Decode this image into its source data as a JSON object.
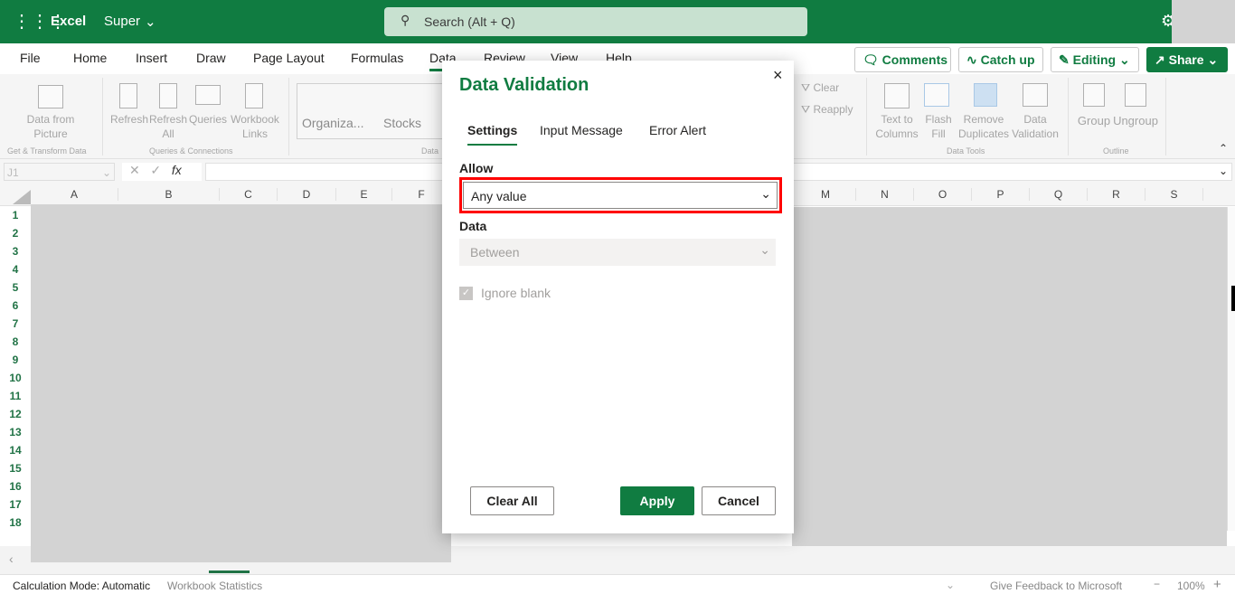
{
  "app": {
    "name": "Excel",
    "doc": "Super",
    "search_placeholder": "Search (Alt + Q)"
  },
  "tabs": [
    "File",
    "Home",
    "Insert",
    "Draw",
    "Page Layout",
    "Formulas",
    "Data",
    "Review",
    "View",
    "Help"
  ],
  "active_tab": "Data",
  "header_buttons": {
    "comments": "Comments",
    "catch_up": "Catch up",
    "editing": "Editing",
    "share": "Share"
  },
  "ribbon": {
    "data_from_picture": "Data from Picture",
    "refresh": "Refresh",
    "refresh_all": "Refresh All",
    "queries": "Queries",
    "workbook_links": "Workbook Links",
    "organiza": "Organiza...",
    "stocks": "Stocks",
    "clear": "Clear",
    "reapply": "Reapply",
    "text_to_columns": "Text to Columns",
    "flash_fill": "Flash Fill",
    "remove_duplicates": "Remove Duplicates",
    "data_validation": "Data Validation",
    "group": "Group",
    "ungroup": "Ungroup",
    "groups": {
      "get_transform": "Get & Transform Data",
      "queries_connections": "Queries & Connections",
      "data_types": "Data",
      "data_tools": "Data Tools",
      "outline": "Outline"
    }
  },
  "formula_bar": {
    "name_box": "J1",
    "fx": "fx",
    "value": ""
  },
  "columns": [
    "A",
    "B",
    "C",
    "D",
    "E",
    "F",
    "M",
    "N",
    "O",
    "P",
    "Q",
    "R",
    "S"
  ],
  "rows": [
    "1",
    "2",
    "3",
    "4",
    "5",
    "6",
    "7",
    "8",
    "9",
    "10",
    "11",
    "12",
    "13",
    "14",
    "15",
    "16",
    "17",
    "18"
  ],
  "dialog": {
    "title": "Data Validation",
    "close": "×",
    "tabs": [
      "Settings",
      "Input Message",
      "Error Alert"
    ],
    "active_tab": "Settings",
    "allow_label": "Allow",
    "allow_value": "Any value",
    "data_label": "Data",
    "data_value": "Between",
    "ignore_blank": "Ignore blank",
    "ignore_blank_checked": true,
    "clear_all": "Clear All",
    "apply": "Apply",
    "cancel": "Cancel",
    "highlight_color": "#ff0000"
  },
  "status": {
    "calc_mode": "Calculation Mode: Automatic",
    "workbook_stats": "Workbook Statistics",
    "feedback": "Give Feedback to Microsoft",
    "zoom": "100%",
    "zoom_out": "−",
    "zoom_in": "+"
  },
  "colors": {
    "brand": "#107c41"
  }
}
